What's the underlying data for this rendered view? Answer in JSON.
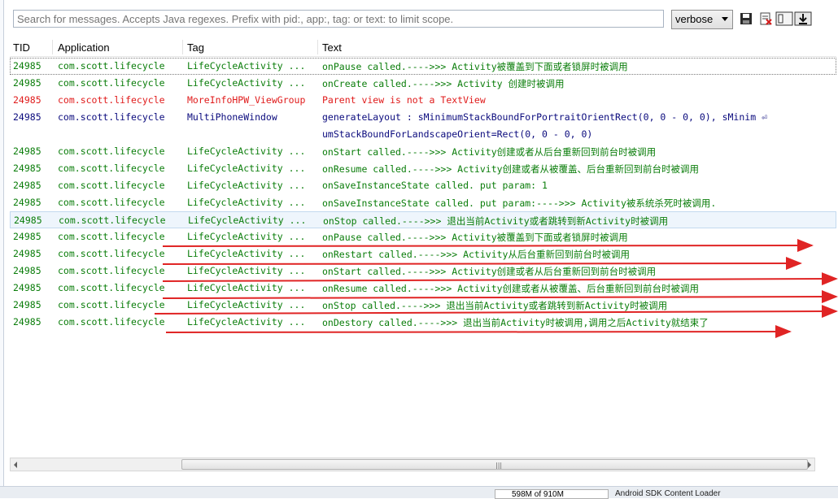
{
  "filter": {
    "placeholder": "Search for messages. Accepts Java regexes. Prefix with pid:, app:, tag: or text: to limit scope.",
    "log_level": "verbose",
    "buttons": [
      "save-icon",
      "clear-log-icon",
      "toggle-panel-icon",
      "scroll-lock-icon"
    ]
  },
  "columns": {
    "tid": "TID",
    "application": "Application",
    "tag": "Tag",
    "text": "Text"
  },
  "colors": {
    "verbose": "#0a7d0a",
    "error": "#e01b1b",
    "debug": "#0a0a7d",
    "annotation_arrow": "#e02424"
  },
  "rows": [
    {
      "tid": "24985",
      "app": "com.scott.lifecycle",
      "tag": "LifeCycleActivity ...",
      "text": "onPause called.---->>> Activity被覆盖到下面或者锁屏时被调用",
      "level": "green",
      "state": "focused"
    },
    {
      "tid": "24985",
      "app": "com.scott.lifecycle",
      "tag": "LifeCycleActivity ...",
      "text": "onCreate called.---->>> Activity 创建时被调用",
      "level": "green"
    },
    {
      "tid": "24985",
      "app": "com.scott.lifecycle",
      "tag": "MoreInfoHPW_ViewGroup",
      "text": "Parent view is not a TextView",
      "level": "red"
    },
    {
      "tid": "24985",
      "app": "com.scott.lifecycle",
      "tag": "MultiPhoneWindow",
      "text": "generateLayout : sMinimumStackBoundForPortraitOrientRect(0, 0 - 0, 0), sMinim ⏎",
      "text2": "umStackBoundForLandscapeOrient=Rect(0, 0 - 0, 0)",
      "level": "blue"
    },
    {
      "tid": "24985",
      "app": "com.scott.lifecycle",
      "tag": "LifeCycleActivity ...",
      "text": "onStart called.---->>> Activity创建或者从后台重新回到前台时被调用",
      "level": "green"
    },
    {
      "tid": "24985",
      "app": "com.scott.lifecycle",
      "tag": "LifeCycleActivity ...",
      "text": "onResume called.---->>> Activity创建或者从被覆盖、后台重新回到前台时被调用",
      "level": "green"
    },
    {
      "tid": "24985",
      "app": "com.scott.lifecycle",
      "tag": "LifeCycleActivity ...",
      "text": "onSaveInstanceState called. put param: 1",
      "level": "green"
    },
    {
      "tid": "24985",
      "app": "com.scott.lifecycle",
      "tag": "LifeCycleActivity ...",
      "text": "onSaveInstanceState called. put param:---->>> Activity被系统杀死时被调用.",
      "level": "green"
    },
    {
      "tid": "24985",
      "app": "com.scott.lifecycle",
      "tag": "LifeCycleActivity ...",
      "text": "onStop called.---->>> 退出当前Activity或者跳转到新Activity时被调用",
      "level": "green",
      "state": "selected"
    },
    {
      "tid": "24985",
      "app": "com.scott.lifecycle",
      "tag": "LifeCycleActivity ...",
      "text": "onPause called.---->>> Activity被覆盖到下面或者锁屏时被调用",
      "level": "green"
    },
    {
      "tid": "24985",
      "app": "com.scott.lifecycle",
      "tag": "LifeCycleActivity ...",
      "text": "onRestart called.---->>> Activity从后台重新回到前台时被调用",
      "level": "green"
    },
    {
      "tid": "24985",
      "app": "com.scott.lifecycle",
      "tag": "LifeCycleActivity ...",
      "text": "onStart called.---->>> Activity创建或者从后台重新回到前台时被调用",
      "level": "green"
    },
    {
      "tid": "24985",
      "app": "com.scott.lifecycle",
      "tag": "LifeCycleActivity ...",
      "text": "onResume called.---->>> Activity创建或者从被覆盖、后台重新回到前台时被调用",
      "level": "green"
    },
    {
      "tid": "24985",
      "app": "com.scott.lifecycle",
      "tag": "LifeCycleActivity ...",
      "text": "onStop called.---->>> 退出当前Activity或者跳转到新Activity时被调用",
      "level": "green"
    },
    {
      "tid": "24985",
      "app": "com.scott.lifecycle",
      "tag": "LifeCycleActivity ...",
      "text": "onDestory called.---->>> 退出当前Activity时被调用,调用之后Activity就结束了",
      "level": "green"
    }
  ],
  "status": {
    "memory": "598M of 910M",
    "sdk": "Android SDK Content Loader"
  }
}
